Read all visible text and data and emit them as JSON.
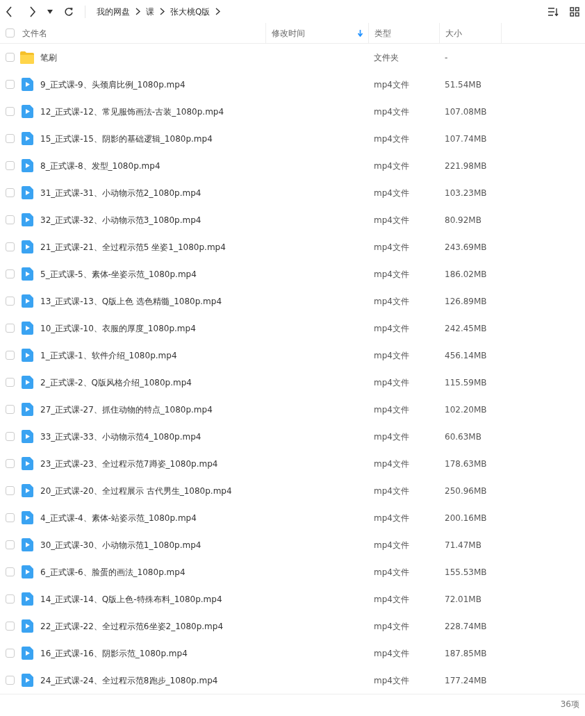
{
  "breadcrumb": [
    "我的网盘",
    "课",
    "张大桃Q版"
  ],
  "select_all": {
    "checked": false
  },
  "columns": [
    {
      "label": "文件名",
      "sorted": false
    },
    {
      "label": "修改时间",
      "sorted": true
    },
    {
      "label": "类型",
      "sorted": false
    },
    {
      "label": "大小",
      "sorted": false
    }
  ],
  "rows": [
    {
      "kind": "folder",
      "name": "笔刷",
      "type": "文件夹",
      "size": "-",
      "checked": false
    },
    {
      "kind": "video",
      "name": "9_正式课-9、头颈肩比例_1080p.mp4",
      "type": "mp4文件",
      "size": "51.54MB",
      "checked": false
    },
    {
      "kind": "video",
      "name": "12_正式课-12、常见服饰画法-古装_1080p.mp4",
      "type": "mp4文件",
      "size": "107.08MB",
      "checked": false
    },
    {
      "kind": "video",
      "name": "15_正式课-15、阴影的基础逻辑_1080p.mp4",
      "type": "mp4文件",
      "size": "107.74MB",
      "checked": false
    },
    {
      "kind": "video",
      "name": "8_正式课-8、发型_1080p.mp4",
      "type": "mp4文件",
      "size": "221.98MB",
      "checked": false
    },
    {
      "kind": "video",
      "name": "31_正式课-31、小动物示范2_1080p.mp4",
      "type": "mp4文件",
      "size": "103.23MB",
      "checked": false
    },
    {
      "kind": "video",
      "name": "32_正式课-32、小动物示范3_1080p.mp4",
      "type": "mp4文件",
      "size": "80.92MB",
      "checked": false
    },
    {
      "kind": "video",
      "name": "21_正式课-21、全过程示范5 坐姿1_1080p.mp4",
      "type": "mp4文件",
      "size": "243.69MB",
      "checked": false
    },
    {
      "kind": "video",
      "name": "5_正式课-5、素体-坐姿示范_1080p.mp4",
      "type": "mp4文件",
      "size": "186.02MB",
      "checked": false
    },
    {
      "kind": "video",
      "name": "13_正式课-13、Q版上色 选色精髓_1080p.mp4",
      "type": "mp4文件",
      "size": "126.89MB",
      "checked": false
    },
    {
      "kind": "video",
      "name": "10_正式课-10、衣服的厚度_1080p.mp4",
      "type": "mp4文件",
      "size": "242.45MB",
      "checked": false
    },
    {
      "kind": "video",
      "name": "1_正式课-1、软件介绍_1080p.mp4",
      "type": "mp4文件",
      "size": "456.14MB",
      "checked": false
    },
    {
      "kind": "video",
      "name": "2_正式课-2、Q版风格介绍_1080p.mp4",
      "type": "mp4文件",
      "size": "115.59MB",
      "checked": false
    },
    {
      "kind": "video",
      "name": "27_正式课-27、抓住动物的特点_1080p.mp4",
      "type": "mp4文件",
      "size": "102.20MB",
      "checked": false
    },
    {
      "kind": "video",
      "name": "33_正式课-33、小动物示范4_1080p.mp4",
      "type": "mp4文件",
      "size": "60.63MB",
      "checked": false
    },
    {
      "kind": "video",
      "name": "23_正式课-23、全过程示范7蹲姿_1080p.mp4",
      "type": "mp4文件",
      "size": "178.63MB",
      "checked": false
    },
    {
      "kind": "video",
      "name": "20_正式课-20、全过程展示 古代男生_1080p.mp4",
      "type": "mp4文件",
      "size": "250.96MB",
      "checked": false
    },
    {
      "kind": "video",
      "name": "4_正式课-4、素体-站姿示范_1080p.mp4",
      "type": "mp4文件",
      "size": "200.16MB",
      "checked": false
    },
    {
      "kind": "video",
      "name": "30_正式课-30、小动物示范1_1080p.mp4",
      "type": "mp4文件",
      "size": "71.47MB",
      "checked": false
    },
    {
      "kind": "video",
      "name": "6_正式课-6、脸蛋的画法_1080p.mp4",
      "type": "mp4文件",
      "size": "155.53MB",
      "checked": false
    },
    {
      "kind": "video",
      "name": "14_正式课-14、Q版上色-特殊布料_1080p.mp4",
      "type": "mp4文件",
      "size": "72.01MB",
      "checked": false
    },
    {
      "kind": "video",
      "name": "22_正式课-22、全过程示范6坐姿2_1080p.mp4",
      "type": "mp4文件",
      "size": "228.74MB",
      "checked": false
    },
    {
      "kind": "video",
      "name": "16_正式课-16、阴影示范_1080p.mp4",
      "type": "mp4文件",
      "size": "187.85MB",
      "checked": false
    },
    {
      "kind": "video",
      "name": "24_正式课-24、全过程示范8跑步_1080p.mp4",
      "type": "mp4文件",
      "size": "177.24MB",
      "checked": false
    }
  ],
  "status_bar": {
    "count": "36项"
  }
}
